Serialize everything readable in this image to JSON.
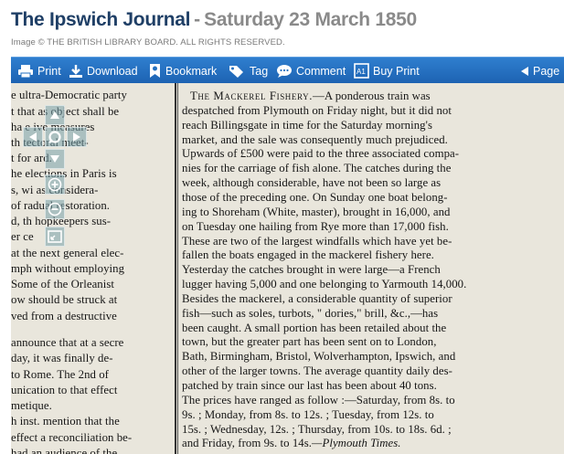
{
  "header": {
    "publication": "The Ipswich Journal",
    "separator": "-",
    "date": "Saturday 23 March 1850",
    "copyright": "Image © THE BRITISH LIBRARY BOARD. ALL RIGHTS RESERVED."
  },
  "toolbar": {
    "print": "Print",
    "download": "Download",
    "bookmark": "Bookmark",
    "tag": "Tag",
    "comment": "Comment",
    "buy_print": "Buy Print",
    "page": "Page"
  },
  "icons": {
    "print": "printer-icon",
    "download": "download-icon",
    "bookmark": "bookmark-icon",
    "tag": "tag-icon",
    "comment": "comment-icon",
    "buy_print": "buy-print-icon",
    "page_prev": "triangle-left-icon",
    "pan_up": "arrow-up-icon",
    "pan_down": "arrow-down-icon",
    "pan_left": "arrow-left-icon",
    "pan_right": "arrow-right-icon",
    "reset": "rotate-icon",
    "zoom_in": "zoom-in-icon",
    "zoom_out": "zoom-out-icon",
    "fit": "fit-screen-icon"
  },
  "colors": {
    "title": "#1f3f66",
    "date": "#8a8a8a",
    "toolbar": "#2471c0"
  },
  "article_left": [
    "e ultra-Democratic party",
    "t that  as object shall be",
    "ha  e  ive measures",
    "th  tectoral meet-",
    "t for  ard.",
    "he elections in Paris is",
    "s, wi  as considera-",
    "of  radual restoration.",
    "d, th  hopkeepers sus-",
    "er ce",
    "at the next general elec-",
    "mph without employing",
    "Some of the Orleanist",
    "ow should be struck at",
    "ved from a destructive",
    "announce that at a secre",
    "day, it was finally de-",
    "to Rome.  The 2nd of",
    "unication to that effect",
    "metique.",
    "h inst. mention that the",
    "effect a reconciliation be-",
    "had an audience of the"
  ],
  "article_right": {
    "heading": "The Mackerel Fishery.",
    "lines": [
      "—A ponderous train was",
      "despatched from Plymouth on Friday night, but it did not",
      "reach Billingsgate in time for the Saturday morning's",
      "market, and the sale was consequently much prejudiced.",
      "Upwards of £500 were paid to the three associated compa-",
      "nies for the carriage of fish alone.  The catches during the",
      "week, although considerable, have not been so large as",
      "those of the preceding one.  On Sunday one boat belong-",
      "ing to Shoreham (White, master), brought in 16,000, and",
      "on Tuesday one hailing from Rye more than 17,000 fish.",
      "These are two of the largest windfalls which have yet be-",
      "fallen the boats engaged in the mackerel fishery here.",
      "Yesterday the catches brought in were large—a French",
      "lugger having 5,000 and one belonging to Yarmouth 14,000.",
      "Besides the mackerel, a considerable quantity of superior",
      "fish—such as soles, turbots, \" dories,\" brill, &c.,—has",
      "been caught.  A small portion has been retailed about the",
      "town, but the greater part has been sent on to London,",
      "Bath, Birmingham, Bristol, Wolverhampton, Ipswich, and",
      "other of the larger towns.  The average quantity daily des-",
      "patched by train since our last has been about 40 tons.",
      "The prices have ranged as follow :—Saturday, from 8s. to",
      "9s. ; Monday, from 8s. to 12s. ; Tuesday, from 12s. to",
      "15s. ; Wednesday, 12s. ; Thursday, from 10s. to 18s. 6d. ;",
      "and Friday, from 9s. to 14s."
    ],
    "source": "—Plymouth Times."
  }
}
